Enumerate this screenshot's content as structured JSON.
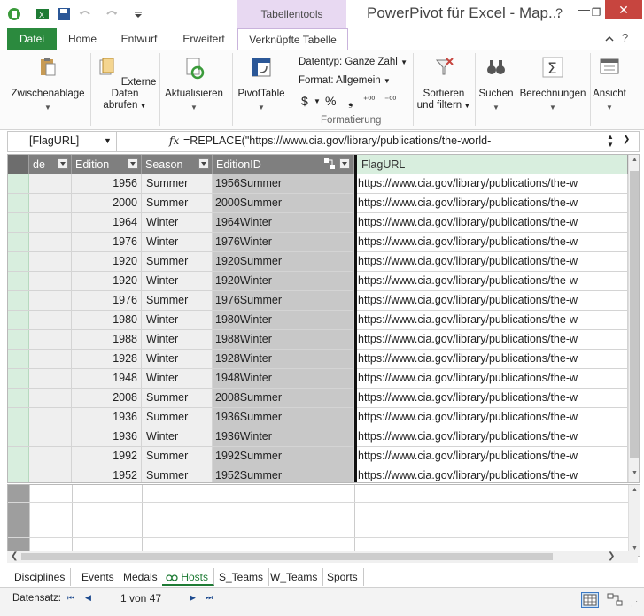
{
  "titlebar": {
    "window_title": "PowerPivot für Excel - Map...",
    "context_label": "Tabellentools",
    "help_glyph": "?",
    "minimize_glyph": "—",
    "restore_glyph": "❐",
    "close_glyph": "✕"
  },
  "tabs": [
    "Datei",
    "Home",
    "Entwurf",
    "Erweitert",
    "Verknüpfte Tabelle"
  ],
  "ribbon": {
    "zwischenablage": "Zwischenablage",
    "externe_daten_1": "Externe Daten",
    "externe_daten_2": "abrufen",
    "aktualisieren": "Aktualisieren",
    "pivottable": "PivotTable",
    "datentyp": "Datentyp: Ganze Zahl",
    "format": "Format: Allgemein",
    "currency": "$",
    "percent": "%",
    "thousands": "❟",
    "dec_increase": "⁺⁰⁰",
    "dec_decrease": "⁻⁰⁰",
    "formatierung": "Formatierung",
    "sortieren_1": "Sortieren",
    "sortieren_2": "und filtern",
    "suchen": "Suchen",
    "berechnungen": "Berechnungen",
    "ansicht": "Ansicht"
  },
  "formula_bar": {
    "name_box": "[FlagURL]",
    "fx": "fx",
    "formula": "=REPLACE(\"https://www.cia.gov/library/publications/the-world-"
  },
  "grid": {
    "headers": {
      "code": "de",
      "edition": "Edition",
      "season": "Season",
      "editionid": "EditionID",
      "flagurl": "FlagURL"
    },
    "url_value": "https://www.cia.gov/library/publications/the-w",
    "rows": [
      {
        "edition": "1956",
        "season": "Summer",
        "id": "1956Summer"
      },
      {
        "edition": "2000",
        "season": "Summer",
        "id": "2000Summer"
      },
      {
        "edition": "1964",
        "season": "Winter",
        "id": "1964Winter"
      },
      {
        "edition": "1976",
        "season": "Winter",
        "id": "1976Winter"
      },
      {
        "edition": "1920",
        "season": "Summer",
        "id": "1920Summer"
      },
      {
        "edition": "1920",
        "season": "Winter",
        "id": "1920Winter"
      },
      {
        "edition": "1976",
        "season": "Summer",
        "id": "1976Summer"
      },
      {
        "edition": "1980",
        "season": "Winter",
        "id": "1980Winter"
      },
      {
        "edition": "1988",
        "season": "Winter",
        "id": "1988Winter"
      },
      {
        "edition": "1928",
        "season": "Winter",
        "id": "1928Winter"
      },
      {
        "edition": "1948",
        "season": "Winter",
        "id": "1948Winter"
      },
      {
        "edition": "2008",
        "season": "Summer",
        "id": "2008Summer"
      },
      {
        "edition": "1936",
        "season": "Summer",
        "id": "1936Summer"
      },
      {
        "edition": "1936",
        "season": "Winter",
        "id": "1936Winter"
      },
      {
        "edition": "1992",
        "season": "Summer",
        "id": "1992Summer"
      },
      {
        "edition": "1952",
        "season": "Summer",
        "id": "1952Summer"
      }
    ]
  },
  "sheet_tabs": [
    "Disciplines",
    "Events",
    "Medals",
    "Hosts",
    "S_Teams",
    "W_Teams",
    "Sports"
  ],
  "active_sheet": "Hosts",
  "status": {
    "record_label": "Datensatz:",
    "record_position": "1 von 47"
  },
  "colors": {
    "accent": "#2b8a3e",
    "context": "#e8d9f2",
    "close": "#c7453f"
  }
}
